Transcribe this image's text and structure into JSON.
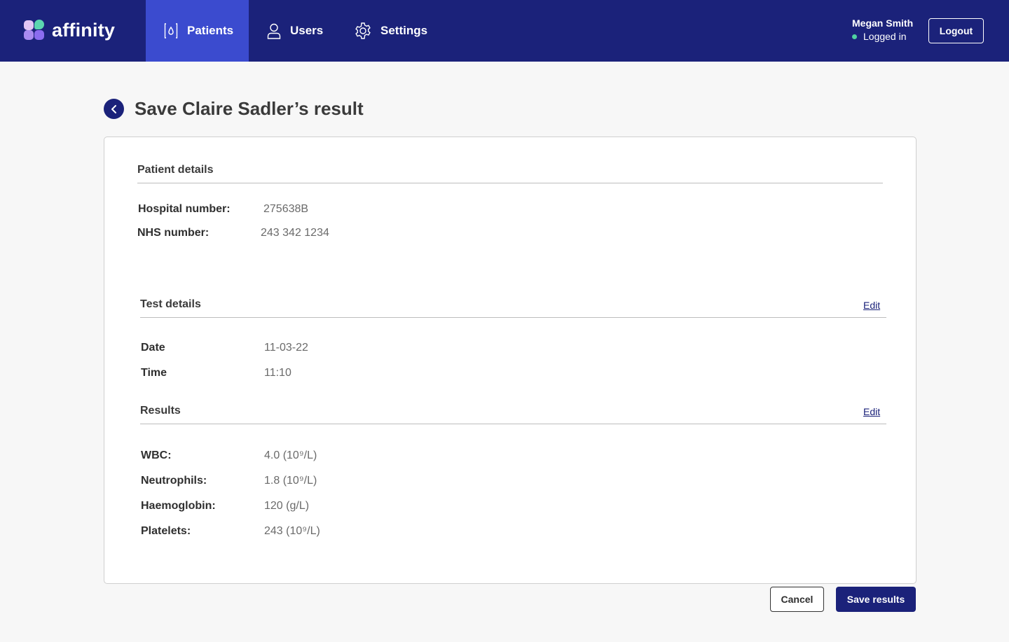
{
  "brand": {
    "name": "affinity"
  },
  "nav": {
    "items": [
      {
        "label": "Patients",
        "icon": "patients-drop-icon",
        "active": true
      },
      {
        "label": "Users",
        "icon": "user-icon",
        "active": false
      },
      {
        "label": "Settings",
        "icon": "gear-icon",
        "active": false
      }
    ]
  },
  "user": {
    "name": "Megan Smith",
    "status": "Logged in",
    "logout_label": "Logout"
  },
  "page": {
    "title": "Save Claire Sadler’s result"
  },
  "patient_details": {
    "title": "Patient details",
    "hospital_number_label": "Hospital number:",
    "hospital_number": "275638B",
    "nhs_number_label": "NHS number:",
    "nhs_number": "243 342 1234"
  },
  "test_details": {
    "title": "Test details",
    "edit_label": "Edit",
    "date_label": "Date",
    "date": "11-03-22",
    "time_label": "Time",
    "time": "11:10"
  },
  "results": {
    "title": "Results",
    "edit_label": "Edit",
    "items": [
      {
        "label": "WBC:",
        "value": "4.0 (10⁹/L)"
      },
      {
        "label": "Neutrophils:",
        "value": "1.8 (10⁹/L)"
      },
      {
        "label": "Haemoglobin:",
        "value": "120 (g/L)"
      },
      {
        "label": "Platelets:",
        "value": "243 (10⁹/L)"
      }
    ]
  },
  "actions": {
    "cancel_label": "Cancel",
    "save_label": "Save results"
  },
  "colors": {
    "nav_bg": "#1b227a",
    "nav_active": "#3b4bcf",
    "status_online": "#4fd1a0",
    "page_bg": "#f7f7f7"
  }
}
